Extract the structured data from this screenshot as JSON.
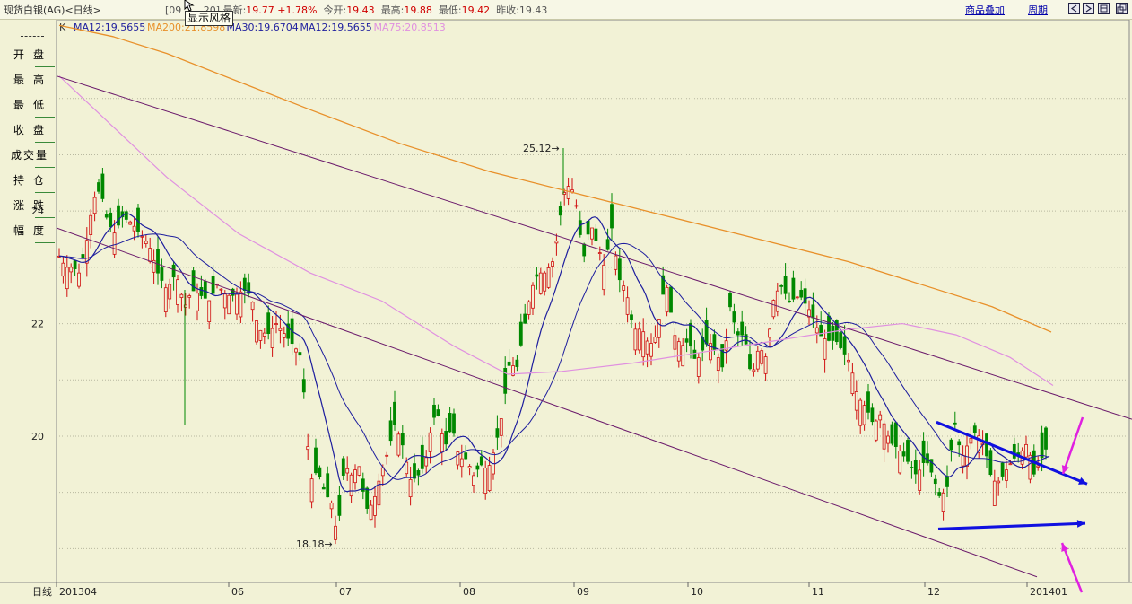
{
  "header": {
    "title": "现货白银(AG)<日线>",
    "time_text": "[09",
    "time_suffix": "20]",
    "latest_label": "最新:",
    "latest_value": "19.77",
    "change_value": "+1.78%",
    "open_label": "今开:",
    "open_value": "19.43",
    "high_label": "最高:",
    "high_value": "19.88",
    "low_label": "最低:",
    "low_value": "19.42",
    "prev_label": "昨收:",
    "prev_value": "19.43",
    "overlay_link": "商品叠加",
    "period_link": "周期"
  },
  "tooltip": "显示风格",
  "ma_legend": {
    "k": "K",
    "items": [
      {
        "text": "MA12:19.5655",
        "color": "#1E1E9E"
      },
      {
        "text": "MA200:21.8598",
        "color": "#E8902A"
      },
      {
        "text": "MA30:19.6704",
        "color": "#1E1E9E"
      },
      {
        "text": "MA12:19.5655",
        "color": "#1E1E9E"
      },
      {
        "text": "MA75:20.8513",
        "color": "#E090E0"
      }
    ]
  },
  "sidebar": {
    "items": [
      "开盘",
      "最高",
      "最低",
      "收盘",
      "成交量",
      "持仓",
      "涨跌",
      "幅度"
    ]
  },
  "chart_data": {
    "type": "candlestick",
    "y_ticks": [
      "24",
      "22",
      "20"
    ],
    "x_ticks": [
      "201304",
      "06",
      "07",
      "08",
      "09",
      "10",
      "11",
      "12",
      "201401"
    ],
    "x_axis_label": "日线",
    "annotations": [
      {
        "text": "25.12",
        "value": 25.12
      },
      {
        "text": "18.18",
        "value": 18.18
      }
    ],
    "ylim": [
      17.4,
      27.4
    ],
    "colors": {
      "up": "#D01010",
      "down": "#008800",
      "ma200": "#E8902A",
      "ma75": "#E090E0",
      "ma_short": "#1E1E9E",
      "channel": "#6B1A6B",
      "arrow_blue": "#1010E0",
      "arrow_magenta": "#E020E0"
    },
    "close_path": [
      [
        0,
        23.2
      ],
      [
        7,
        23.0
      ],
      [
        16,
        23.0
      ],
      [
        22,
        22.9
      ],
      [
        30,
        23.4
      ],
      [
        38,
        24.2
      ],
      [
        46,
        24.4
      ],
      [
        54,
        23.8
      ],
      [
        62,
        23.6
      ],
      [
        70,
        23.9
      ],
      [
        80,
        23.8
      ],
      [
        90,
        23.6
      ],
      [
        100,
        23.4
      ],
      [
        110,
        22.9
      ],
      [
        120,
        22.6
      ],
      [
        130,
        22.9
      ],
      [
        140,
        22.3
      ],
      [
        148,
        22.6
      ],
      [
        158,
        22.5
      ],
      [
        168,
        22.4
      ],
      [
        176,
        22.7
      ],
      [
        186,
        22.5
      ],
      [
        196,
        22.5
      ],
      [
        206,
        22.6
      ],
      [
        214,
        22.5
      ],
      [
        222,
        21.9
      ],
      [
        232,
        21.8
      ],
      [
        242,
        22.0
      ],
      [
        252,
        21.8
      ],
      [
        262,
        21.6
      ],
      [
        270,
        21.4
      ],
      [
        280,
        19.2
      ],
      [
        288,
        19.4
      ],
      [
        296,
        19.0
      ],
      [
        304,
        18.8
      ],
      [
        310,
        18.2
      ],
      [
        318,
        19.5
      ],
      [
        326,
        19.3
      ],
      [
        334,
        19.5
      ],
      [
        342,
        18.7
      ],
      [
        350,
        18.8
      ],
      [
        358,
        19.3
      ],
      [
        366,
        19.7
      ],
      [
        374,
        20.2
      ],
      [
        382,
        19.9
      ],
      [
        392,
        19.2
      ],
      [
        400,
        19.3
      ],
      [
        408,
        19.5
      ],
      [
        416,
        20.3
      ],
      [
        422,
        20.4
      ],
      [
        430,
        19.8
      ],
      [
        438,
        20.2
      ],
      [
        446,
        19.6
      ],
      [
        454,
        19.6
      ],
      [
        462,
        19.3
      ],
      [
        470,
        19.5
      ],
      [
        478,
        19.4
      ],
      [
        486,
        19.8
      ],
      [
        494,
        20.4
      ],
      [
        502,
        21.3
      ],
      [
        510,
        21.2
      ],
      [
        518,
        21.9
      ],
      [
        526,
        22.6
      ],
      [
        534,
        22.9
      ],
      [
        542,
        22.9
      ],
      [
        550,
        23.1
      ],
      [
        556,
        23.6
      ],
      [
        562,
        24.3
      ],
      [
        570,
        24.5
      ],
      [
        578,
        24.0
      ],
      [
        584,
        23.1
      ],
      [
        592,
        23.8
      ],
      [
        600,
        23.4
      ],
      [
        608,
        23.0
      ],
      [
        616,
        23.7
      ],
      [
        624,
        22.8
      ],
      [
        632,
        22.6
      ],
      [
        640,
        21.9
      ],
      [
        650,
        21.9
      ],
      [
        658,
        21.6
      ],
      [
        666,
        21.8
      ],
      [
        676,
        22.8
      ],
      [
        686,
        21.8
      ],
      [
        694,
        21.6
      ],
      [
        702,
        21.7
      ],
      [
        710,
        21.3
      ],
      [
        716,
        21.5
      ],
      [
        724,
        21.7
      ],
      [
        732,
        21.5
      ],
      [
        740,
        21.2
      ],
      [
        748,
        22.3
      ],
      [
        756,
        21.8
      ],
      [
        764,
        21.8
      ],
      [
        772,
        21.0
      ],
      [
        780,
        21.6
      ],
      [
        788,
        21.4
      ],
      [
        796,
        22.4
      ],
      [
        804,
        22.7
      ],
      [
        814,
        22.4
      ],
      [
        826,
        22.5
      ],
      [
        838,
        22.2
      ],
      [
        848,
        21.8
      ],
      [
        856,
        21.7
      ],
      [
        866,
        21.7
      ],
      [
        874,
        21.5
      ],
      [
        882,
        21.3
      ],
      [
        890,
        20.7
      ],
      [
        900,
        20.5
      ],
      [
        908,
        20.2
      ],
      [
        916,
        20.4
      ],
      [
        926,
        19.9
      ],
      [
        934,
        19.8
      ],
      [
        944,
        19.6
      ],
      [
        956,
        19.3
      ],
      [
        966,
        19.6
      ],
      [
        974,
        19.3
      ],
      [
        982,
        18.9
      ],
      [
        990,
        19.1
      ],
      [
        998,
        20.3
      ],
      [
        1006,
        19.6
      ],
      [
        1014,
        19.9
      ],
      [
        1022,
        20.1
      ],
      [
        1032,
        19.8
      ],
      [
        1040,
        19.2
      ],
      [
        1048,
        19.2
      ],
      [
        1056,
        19.4
      ],
      [
        1064,
        19.6
      ],
      [
        1072,
        19.7
      ],
      [
        1080,
        19.9
      ],
      [
        1086,
        19.3
      ],
      [
        1092,
        19.5
      ],
      [
        1100,
        19.77
      ]
    ]
  }
}
